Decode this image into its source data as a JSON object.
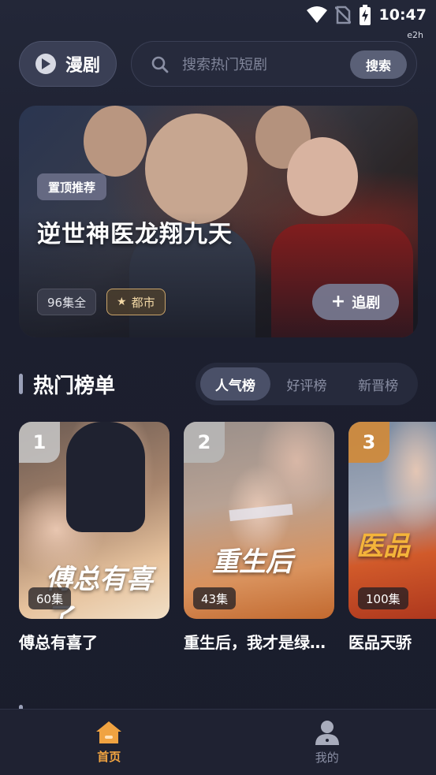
{
  "status_bar": {
    "time": "10:47",
    "tag": "e2h"
  },
  "header": {
    "mode_label": "漫剧",
    "search_placeholder": "搜索热门短剧",
    "search_button": "搜索"
  },
  "banner": {
    "badge": "置顶推荐",
    "title": "逆世神医龙翔九天",
    "episodes": "96集全",
    "genre": "都市",
    "follow_label": "追剧"
  },
  "ranking": {
    "title": "热门榜单",
    "tabs": [
      {
        "label": "人气榜",
        "active": true
      },
      {
        "label": "好评榜",
        "active": false
      },
      {
        "label": "新晋榜",
        "active": false
      }
    ],
    "items": [
      {
        "rank": "1",
        "episodes": "60集",
        "name": "傅总有喜了",
        "cover_text": "傅总有喜了",
        "rank_color": "#c9c9c9"
      },
      {
        "rank": "2",
        "episodes": "43集",
        "name": "重生后，我才是绿茶祖宗",
        "cover_text": "重生后",
        "rank_color": "#b9b9b9"
      },
      {
        "rank": "3",
        "episodes": "100集",
        "name": "医品天骄",
        "cover_text": "医品",
        "rank_color": "#d08a3a"
      }
    ]
  },
  "bottom_nav": [
    {
      "label": "首页",
      "icon": "home-icon",
      "active": true
    },
    {
      "label": "我的",
      "icon": "profile-icon",
      "active": false
    }
  ],
  "colors": {
    "accent": "#f0a341",
    "background": "#1b1e2e"
  }
}
